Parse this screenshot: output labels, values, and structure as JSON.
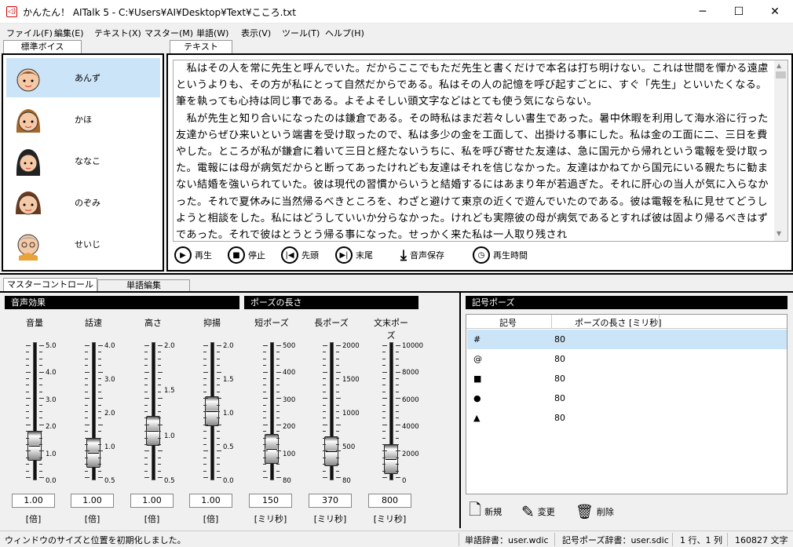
{
  "window": {
    "title": "かんたん！ AITalk 5 - C:¥Users¥AI¥Desktop¥Text¥こころ.txt",
    "minimize": "─",
    "maximize": "☐",
    "close": "✕"
  },
  "menu": [
    "ファイル(F)",
    "編集(E)",
    "テキスト(X)",
    "マスター(M)",
    "単語(W)",
    "表示(V)",
    "ツール(T)",
    "ヘルプ(H)"
  ],
  "voice_panel": {
    "tab": "標準ボイス",
    "voices": [
      "あんず",
      "かほ",
      "ななこ",
      "のぞみ",
      "せいじ"
    ]
  },
  "text_panel": {
    "tab": "テキスト",
    "content": "　私はその人を常に先生と呼んでいた。だからここでもただ先生と書くだけで本名は打ち明けない。これは世間を憚かる遠慮というよりも、その方が私にとって自然だからである。私はその人の記憶を呼び起すごとに、すぐ「先生」といいたくなる。筆を執っても心持は同じ事である。よそよそしい頭文字などはとても使う気にならない。\n　私が先生と知り合いになったのは鎌倉である。その時私はまだ若々しい書生であった。暑中休暇を利用して海水浴に行った友達からぜひ来いという端書を受け取ったので、私は多少の金を工面して、出掛ける事にした。私は金の工面に二、三日を費やした。ところが私が鎌倉に着いて三日と経たないうちに、私を呼び寄せた友達は、急に国元から帰れという電報を受け取った。電報には母が病気だからと断ってあったけれども友達はそれを信じなかった。友達はかねてから国元にいる親たちに勧まない結婚を強いられていた。彼は現代の習慣からいうと結婚するにはあまり年が若過ぎた。それに肝心の当人が気に入らなかった。それで夏休みに当然帰るべきところを、わざと避けて東京の近くで遊んでいたのである。彼は電報を私に見せてどうしようと相談をした。私にはどうしていいか分らなかった。けれども実際彼の母が病気であるとすれば彼は固より帰るべきはずであった。それで彼はとうとう帰る事になった。せっかく来た私は一人取り残され",
    "buttons": {
      "play": "再生",
      "stop": "停止",
      "head": "先頭",
      "tail": "末尾",
      "save": "音声保存",
      "time": "再生時間"
    }
  },
  "control": {
    "tabs": [
      "マスターコントロール",
      "単語編集"
    ],
    "effects_header": "音声効果",
    "pause_header": "ポーズの長さ",
    "sliders": [
      {
        "label": "音量",
        "value": "1.00",
        "unit": "[倍]",
        "ticks": [
          "5.0",
          "4.0",
          "3.0",
          "2.0",
          "1.0",
          "0.0"
        ],
        "level": 0.2
      },
      {
        "label": "話速",
        "value": "1.00",
        "unit": "[倍]",
        "ticks": [
          "4.0",
          "3.0",
          "2.0",
          "1.0",
          "0.5"
        ],
        "level": 0.14
      },
      {
        "label": "高さ",
        "value": "1.00",
        "unit": "[倍]",
        "ticks": [
          "2.0",
          "1.5",
          "1.0",
          "0.5"
        ],
        "level": 0.33
      },
      {
        "label": "抑揚",
        "value": "1.00",
        "unit": "[倍]",
        "ticks": [
          "2.0",
          "1.5",
          "1.0",
          "0.5",
          "0.0"
        ],
        "level": 0.5
      },
      {
        "label": "短ポーズ",
        "value": "150",
        "unit": "[ミリ秒]",
        "ticks": [
          "500",
          "400",
          "300",
          "200",
          "100",
          "80"
        ],
        "level": 0.17
      },
      {
        "label": "長ポーズ",
        "value": "370",
        "unit": "[ミリ秒]",
        "ticks": [
          "2000",
          "1500",
          "1000",
          "500",
          "80"
        ],
        "level": 0.15
      },
      {
        "label": "文末ポーズ",
        "value": "800",
        "unit": "[ミリ秒]",
        "ticks": [
          "10000",
          "8000",
          "6000",
          "4000",
          "2000",
          "0"
        ],
        "level": 0.08
      }
    ]
  },
  "symbol_pause": {
    "header": "記号ポーズ",
    "columns": [
      "記号",
      "ポーズの長さ [ミリ秒]"
    ],
    "rows": [
      [
        "#",
        "80"
      ],
      [
        "@",
        "80"
      ],
      [
        "■",
        "80"
      ],
      [
        "●",
        "80"
      ],
      [
        "▲",
        "80"
      ]
    ],
    "buttons": {
      "new": "新規",
      "edit": "変更",
      "delete": "削除"
    }
  },
  "status": {
    "message": "ウィンドウのサイズと位置を初期化しました。",
    "word_dict": "単語辞書：user.wdic",
    "symbol_dict": "記号ポーズ辞書：user.sdic",
    "position": "1 行、1 列",
    "count": "160827 文字"
  }
}
